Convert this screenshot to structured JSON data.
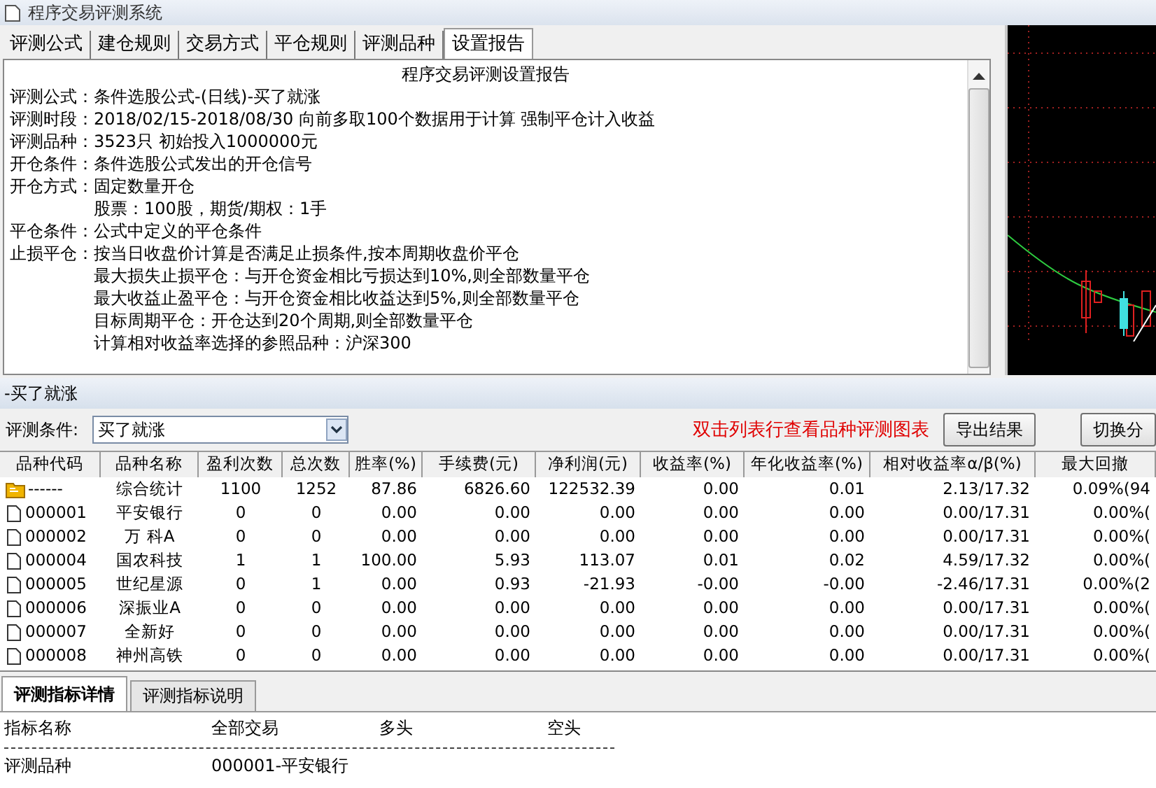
{
  "window": {
    "title": "程序交易评测系统"
  },
  "tabs": [
    {
      "label": "评测公式",
      "selected": false
    },
    {
      "label": "建仓规则",
      "selected": false
    },
    {
      "label": "交易方式",
      "selected": false
    },
    {
      "label": "平仓规则",
      "selected": false
    },
    {
      "label": "评测品种",
      "selected": false
    },
    {
      "label": "设置报告",
      "selected": true
    }
  ],
  "report": {
    "title": "程序交易评测设置报告",
    "lines": [
      {
        "label": "评测公式：",
        "text": "条件选股公式-(日线)-买了就涨"
      },
      {
        "label": "评测时段：",
        "text": "2018/02/15-2018/08/30 向前多取100个数据用于计算 强制平仓计入收益"
      },
      {
        "label": "评测品种：",
        "text": "3523只 初始投入1000000元"
      },
      {
        "label": "开仓条件：",
        "text": "条件选股公式发出的开仓信号"
      },
      {
        "label": "开仓方式：",
        "text": "固定数量开仓"
      },
      {
        "text": "股票：100股，期货/期权：1手"
      },
      {
        "label": "平仓条件：",
        "text": "公式中定义的平仓条件"
      },
      {
        "label": "止损平仓：",
        "text": "按当日收盘价计算是否满足止损条件,按本周期收盘价平仓"
      },
      {
        "text": "最大损失止损平仓：与开仓资金相比亏损达到10%,则全部数量平仓"
      },
      {
        "text": "最大收益止盈平仓：与开仓资金相比收益达到5%,则全部数量平仓"
      },
      {
        "text": "目标周期平仓：开仓达到20个周期,则全部数量平仓"
      },
      {
        "text": "计算相对收益率选择的参照品种：沪深300"
      }
    ]
  },
  "section": {
    "title": "-买了就涨"
  },
  "condition": {
    "label": "评测条件:",
    "value": "买了就涨"
  },
  "hint": "双击列表行查看品种评测图表",
  "buttons": [
    "导出结果",
    "切换分"
  ],
  "table": {
    "columns": [
      "品种代码",
      "品种名称",
      "盈利次数",
      "总次数",
      "胜率(%)",
      "手续费(元)",
      "净利润(元)",
      "收益率(%)",
      "年化收益率(%)",
      "相对收益率α/β(%)",
      "最大回撤"
    ],
    "rows": [
      {
        "kind": "summary",
        "cells": [
          "------",
          "综合统计",
          "1100",
          "1252",
          "87.86",
          "6826.60",
          "122532.39",
          "0.00",
          "0.01",
          "2.13/17.32",
          "0.09%(94"
        ]
      },
      {
        "kind": "stock",
        "cells": [
          "000001",
          "平安银行",
          "0",
          "0",
          "0.00",
          "0.00",
          "0.00",
          "0.00",
          "0.00",
          "0.00/17.31",
          "0.00%("
        ]
      },
      {
        "kind": "stock",
        "cells": [
          "000002",
          "万 科A",
          "0",
          "0",
          "0.00",
          "0.00",
          "0.00",
          "0.00",
          "0.00",
          "0.00/17.31",
          "0.00%("
        ]
      },
      {
        "kind": "stock",
        "cells": [
          "000004",
          "国农科技",
          "1",
          "1",
          "100.00",
          "5.93",
          "113.07",
          "0.01",
          "0.02",
          "4.59/17.32",
          "0.00%("
        ]
      },
      {
        "kind": "stock",
        "cells": [
          "000005",
          "世纪星源",
          "0",
          "1",
          "0.00",
          "0.93",
          "-21.93",
          "-0.00",
          "-0.00",
          "-2.46/17.31",
          "0.00%(2"
        ]
      },
      {
        "kind": "stock",
        "cells": [
          "000006",
          "深振业A",
          "0",
          "0",
          "0.00",
          "0.00",
          "0.00",
          "0.00",
          "0.00",
          "0.00/17.31",
          "0.00%("
        ]
      },
      {
        "kind": "stock",
        "cells": [
          "000007",
          "全新好",
          "0",
          "0",
          "0.00",
          "0.00",
          "0.00",
          "0.00",
          "0.00",
          "0.00/17.31",
          "0.00%("
        ]
      },
      {
        "kind": "stock",
        "cells": [
          "000008",
          "神州高铁",
          "0",
          "0",
          "0.00",
          "0.00",
          "0.00",
          "0.00",
          "0.00",
          "0.00/17.31",
          "0.00%("
        ]
      }
    ]
  },
  "detail_tabs": [
    {
      "label": "评测指标详情",
      "selected": true
    },
    {
      "label": "评测指标说明",
      "selected": false
    }
  ],
  "detail": {
    "columns": [
      "指标名称",
      "全部交易",
      "多头",
      "空头"
    ],
    "rows": [
      [
        "评测品种",
        "000001-平安银行"
      ]
    ]
  }
}
